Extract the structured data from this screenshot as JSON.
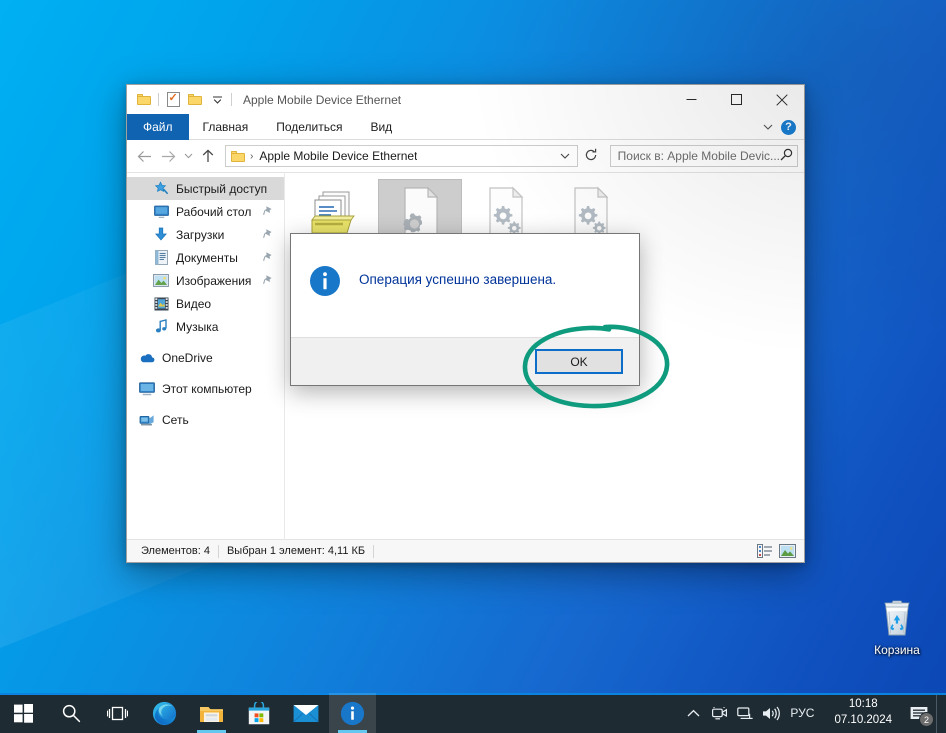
{
  "desktop": {
    "recycle_bin": {
      "label": "Корзина",
      "icon": "recycle-bin-icon"
    }
  },
  "explorer": {
    "titlebar": {
      "title": "Apple Mobile Device Ethernet",
      "qat": [
        {
          "name": "folder-icon",
          "label": ""
        },
        {
          "name": "properties-icon",
          "label": ""
        },
        {
          "name": "new-folder-icon",
          "label": ""
        },
        {
          "name": "customize-qat-caret-icon",
          "label": "▾"
        }
      ],
      "controls": {
        "minimize": "minimize-icon",
        "maximize": "maximize-icon",
        "close": "close-icon"
      }
    },
    "ribbon": {
      "tabs": [
        {
          "label": "Файл",
          "active": true
        },
        {
          "label": "Главная",
          "active": false
        },
        {
          "label": "Поделиться",
          "active": false
        },
        {
          "label": "Вид",
          "active": false
        }
      ],
      "collapse_icon": "chevron-down-icon",
      "help_label": "?"
    },
    "address": {
      "back_icon": "arrow-left-icon",
      "forward_icon": "arrow-right-icon",
      "recent_icon": "chevron-down-icon",
      "up_icon": "arrow-up-icon",
      "folder_icon": "folder-icon",
      "separator": "›",
      "path": "Apple Mobile Device Ethernet",
      "dropdown_icon": "chevron-down-icon",
      "refresh_icon": "refresh-icon",
      "search_placeholder": "Поиск в: Apple Mobile Devic...",
      "search_icon": "search-icon"
    },
    "navpane": {
      "items": [
        {
          "label": "Быстрый доступ",
          "icon": "star-pin-icon",
          "level": 0,
          "selected": true,
          "pinned": false
        },
        {
          "label": "Рабочий стол",
          "icon": "desktop-icon",
          "level": 1,
          "selected": false,
          "pinned": true
        },
        {
          "label": "Загрузки",
          "icon": "downloads-icon",
          "level": 1,
          "selected": false,
          "pinned": true
        },
        {
          "label": "Документы",
          "icon": "documents-icon",
          "level": 1,
          "selected": false,
          "pinned": true
        },
        {
          "label": "Изображения",
          "icon": "pictures-icon",
          "level": 1,
          "selected": false,
          "pinned": true
        },
        {
          "label": "Видео",
          "icon": "videos-icon",
          "level": 1,
          "selected": false,
          "pinned": false
        },
        {
          "label": "Музыка",
          "icon": "music-icon",
          "level": 1,
          "selected": false,
          "pinned": false
        },
        {
          "label": "OneDrive",
          "icon": "onedrive-cloud-icon",
          "level": 0,
          "selected": false,
          "pinned": false
        },
        {
          "label": "Этот компьютер",
          "icon": "this-pc-icon",
          "level": 0,
          "selected": false,
          "pinned": false
        },
        {
          "label": "Сеть",
          "icon": "network-icon",
          "level": 0,
          "selected": false,
          "pinned": false
        }
      ]
    },
    "files": [
      {
        "name": "",
        "icon": "catalog-file-icon",
        "selected": false
      },
      {
        "name": "",
        "icon": "system-file-icon",
        "selected": true
      },
      {
        "name": "",
        "icon": "setup-information-file-icon",
        "selected": false
      },
      {
        "name": "",
        "icon": "setup-information-file-icon",
        "selected": false
      }
    ],
    "statusbar": {
      "count_text": "Элементов: 4",
      "selection_text": "Выбран 1 элемент: 4,11 КБ",
      "details_view_icon": "details-view-icon",
      "large_icons_view_icon": "large-icons-view-icon"
    }
  },
  "dialog": {
    "icon": "info-icon",
    "message": "Операция успешно завершена.",
    "ok_label": "OK"
  },
  "annotation": {
    "shape": "ellipse",
    "color": "#0f9b7e",
    "target": "ok-button"
  },
  "taskbar": {
    "buttons": [
      {
        "name": "start-button",
        "icon": "windows-logo-icon"
      },
      {
        "name": "search-button",
        "icon": "search-icon"
      },
      {
        "name": "task-view-button",
        "icon": "task-view-icon"
      },
      {
        "name": "edge-button",
        "icon": "edge-icon"
      },
      {
        "name": "file-explorer-button",
        "icon": "file-explorer-icon"
      },
      {
        "name": "microsoft-store-button",
        "icon": "store-icon"
      },
      {
        "name": "mail-button",
        "icon": "mail-icon"
      },
      {
        "name": "info-dialog-button",
        "icon": "info-icon"
      }
    ],
    "tray": {
      "overflow_icon": "chevron-up-icon",
      "icons": [
        {
          "name": "camera-privacy-icon"
        },
        {
          "name": "network-icon"
        },
        {
          "name": "volume-icon"
        }
      ],
      "language": "РУС",
      "time": "10:18",
      "date": "07.10.2024",
      "action_center_icon": "action-center-icon",
      "notification_count": "2"
    }
  }
}
